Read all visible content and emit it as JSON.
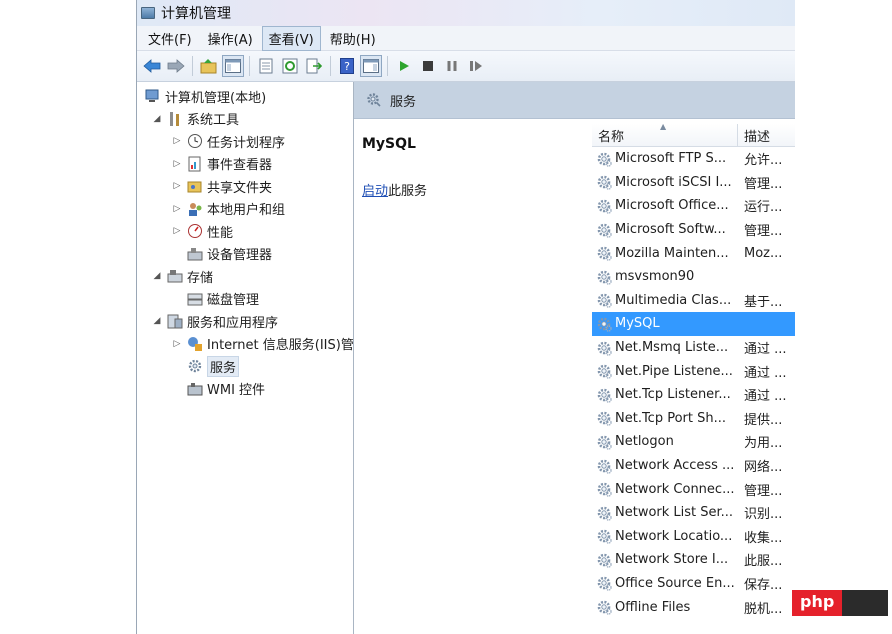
{
  "window": {
    "title": "计算机管理"
  },
  "menu": [
    "文件(F)",
    "操作(A)",
    "查看(V)",
    "帮助(H)"
  ],
  "active_menu_index": 2,
  "toolbar": {
    "icons": [
      "back-icon",
      "forward-icon",
      "up-folder-icon",
      "show-hide-tree-icon",
      "properties-icon",
      "refresh-icon",
      "export-list-icon",
      "help-icon",
      "show-action-pane-icon",
      "start-service-icon",
      "stop-service-icon",
      "pause-service-icon",
      "restart-service-icon"
    ]
  },
  "tree": [
    {
      "label": "计算机管理(本地)",
      "level": 0,
      "expand": "",
      "icon": "computer-management-icon"
    },
    {
      "label": "系统工具",
      "level": 1,
      "expand": "open",
      "icon": "system-tools-icon"
    },
    {
      "label": "任务计划程序",
      "level": 2,
      "expand": "closed",
      "icon": "task-scheduler-icon"
    },
    {
      "label": "事件查看器",
      "level": 2,
      "expand": "closed",
      "icon": "event-viewer-icon"
    },
    {
      "label": "共享文件夹",
      "level": 2,
      "expand": "closed",
      "icon": "shared-folders-icon"
    },
    {
      "label": "本地用户和组",
      "level": 2,
      "expand": "closed",
      "icon": "local-users-icon"
    },
    {
      "label": "性能",
      "level": 2,
      "expand": "closed",
      "icon": "performance-icon"
    },
    {
      "label": "设备管理器",
      "level": 2,
      "expand": "",
      "icon": "device-manager-icon"
    },
    {
      "label": "存储",
      "level": 1,
      "expand": "open",
      "icon": "storage-icon"
    },
    {
      "label": "磁盘管理",
      "level": 2,
      "expand": "",
      "icon": "disk-management-icon"
    },
    {
      "label": "服务和应用程序",
      "level": 1,
      "expand": "open",
      "icon": "services-applications-icon"
    },
    {
      "label": "Internet 信息服务(IIS)管",
      "level": 2,
      "expand": "closed",
      "icon": "iis-icon"
    },
    {
      "label": "服务",
      "level": 2,
      "expand": "",
      "icon": "services-gear-icon",
      "selected": true
    },
    {
      "label": "WMI 控件",
      "level": 2,
      "expand": "",
      "icon": "wmi-control-icon"
    }
  ],
  "main": {
    "header_title": "服务",
    "selected_service": "MySQL",
    "action_link": "启动",
    "action_text": "此服务",
    "columns": {
      "name": "名称",
      "desc": "描述"
    }
  },
  "services": [
    {
      "name": "Microsoft FTP S...",
      "desc": "允许..."
    },
    {
      "name": "Microsoft iSCSI I...",
      "desc": "管理..."
    },
    {
      "name": "Microsoft Office...",
      "desc": "运行..."
    },
    {
      "name": "Microsoft Softw...",
      "desc": "管理..."
    },
    {
      "name": "Mozilla Mainten...",
      "desc": "Moz..."
    },
    {
      "name": "msvsmon90",
      "desc": ""
    },
    {
      "name": "Multimedia Clas...",
      "desc": "基于..."
    },
    {
      "name": "MySQL",
      "desc": "",
      "selected": true
    },
    {
      "name": "Net.Msmq Liste...",
      "desc": "通过 ..."
    },
    {
      "name": "Net.Pipe Listene...",
      "desc": "通过 ..."
    },
    {
      "name": "Net.Tcp Listener...",
      "desc": "通过 ..."
    },
    {
      "name": "Net.Tcp Port Sh...",
      "desc": "提供..."
    },
    {
      "name": "Netlogon",
      "desc": "为用..."
    },
    {
      "name": "Network Access ...",
      "desc": "网络..."
    },
    {
      "name": "Network Connec...",
      "desc": "管理..."
    },
    {
      "name": "Network List Ser...",
      "desc": "识别..."
    },
    {
      "name": "Network Locatio...",
      "desc": "收集..."
    },
    {
      "name": "Network Store I...",
      "desc": "此服..."
    },
    {
      "name": "Office Source En...",
      "desc": "保存..."
    },
    {
      "name": "Offline Files",
      "desc": "脱机..."
    }
  ],
  "watermark": {
    "text": "php"
  },
  "colors": {
    "selection": "#3399ff",
    "header_band": "#c5d2e1",
    "link": "#1f4fb5",
    "watermark_red": "#e5212b"
  }
}
